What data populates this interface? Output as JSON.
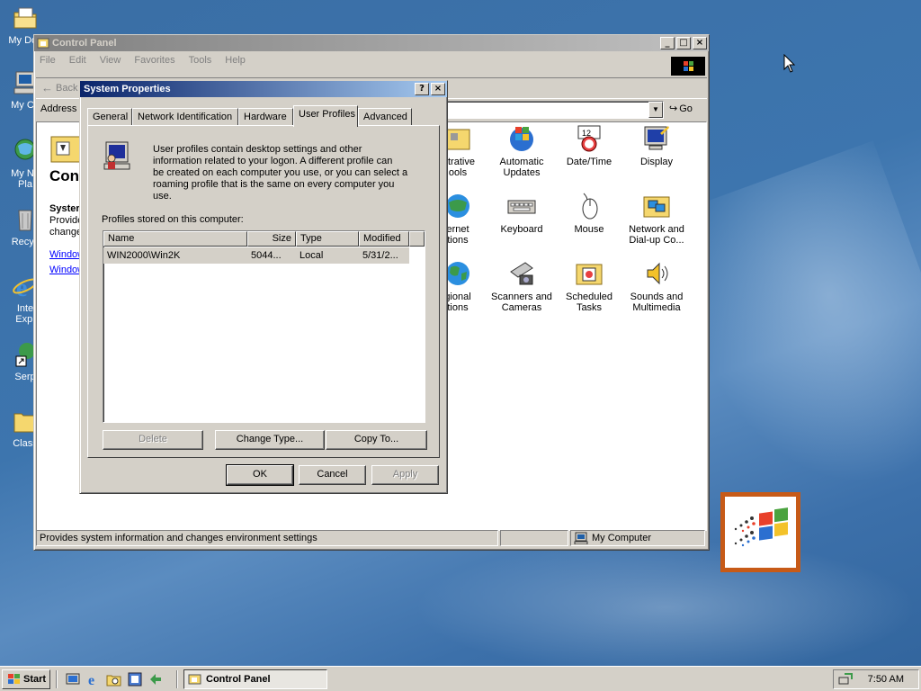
{
  "desktop": {
    "icons": [
      {
        "label": "My Doc",
        "icon": "folder-documents-icon"
      },
      {
        "label": "My Co",
        "icon": "my-computer-icon"
      },
      {
        "label": "My Ne",
        "label2": "Pla",
        "icon": "network-places-icon"
      },
      {
        "label": "Recyc",
        "icon": "recycle-bin-icon"
      },
      {
        "label": "Inte",
        "label2": "Expl",
        "icon": "internet-explorer-icon"
      },
      {
        "label": "Serp",
        "icon": "shortcut-icon"
      },
      {
        "label": "Class",
        "icon": "folder-icon"
      }
    ]
  },
  "control_panel": {
    "title": "Control Panel",
    "menu": [
      "File",
      "Edit",
      "View",
      "Favorites",
      "Tools",
      "Help"
    ],
    "toolbar": {
      "back_label": "Back"
    },
    "address": {
      "label": "Address",
      "go_label": "Go"
    },
    "left_pane": {
      "title": "Cont",
      "system_heading": "Syster",
      "desc1": "Provide",
      "desc2": "change",
      "link1": "Window",
      "link2": "Window"
    },
    "items": [
      {
        "label": "istrative",
        "label2": "ools",
        "icon": "admin-tools-icon"
      },
      {
        "label": "Automatic",
        "label2": "Updates",
        "icon": "automatic-updates-icon"
      },
      {
        "label": "Date/Time",
        "label2": "",
        "icon": "date-time-icon"
      },
      {
        "label": "Display",
        "label2": "",
        "icon": "display-icon"
      },
      {
        "label": "ernet",
        "label2": "tions",
        "icon": "internet-options-icon"
      },
      {
        "label": "Keyboard",
        "label2": "",
        "icon": "keyboard-icon"
      },
      {
        "label": "Mouse",
        "label2": "",
        "icon": "mouse-icon"
      },
      {
        "label": "Network and",
        "label2": "Dial-up Co...",
        "icon": "network-dialup-icon"
      },
      {
        "label": "gional",
        "label2": "tions",
        "icon": "regional-options-icon"
      },
      {
        "label": "Scanners and",
        "label2": "Cameras",
        "icon": "scanner-camera-icon"
      },
      {
        "label": "Scheduled",
        "label2": "Tasks",
        "icon": "scheduled-tasks-icon"
      },
      {
        "label": "Sounds and",
        "label2": "Multimedia",
        "icon": "sounds-multimedia-icon"
      }
    ],
    "status": {
      "text": "Provides system information and changes environment settings",
      "zone": "My Computer"
    }
  },
  "system_properties": {
    "title": "System Properties",
    "tabs": [
      "General",
      "Network Identification",
      "Hardware",
      "User Profiles",
      "Advanced"
    ],
    "selected_tab": "User Profiles",
    "description": [
      "User profiles contain desktop settings and other",
      "information related to your logon.  A different profile can",
      "be created on each computer you use, or you can select a",
      "roaming profile that is the same on every computer you",
      "use."
    ],
    "profiles_label": "Profiles stored on this computer:",
    "columns": [
      "Name",
      "Size",
      "Type",
      "Modified"
    ],
    "rows": [
      {
        "name": "WIN2000\\Win2K",
        "size": "5044...",
        "type": "Local",
        "modified": "5/31/2..."
      }
    ],
    "buttons": {
      "delete": "Delete",
      "change_type": "Change Type...",
      "copy_to": "Copy To...",
      "ok": "OK",
      "cancel": "Cancel",
      "apply": "Apply"
    }
  },
  "taskbar": {
    "start_label": "Start",
    "task_label": "Control Panel",
    "clock": "7:50 AM"
  }
}
